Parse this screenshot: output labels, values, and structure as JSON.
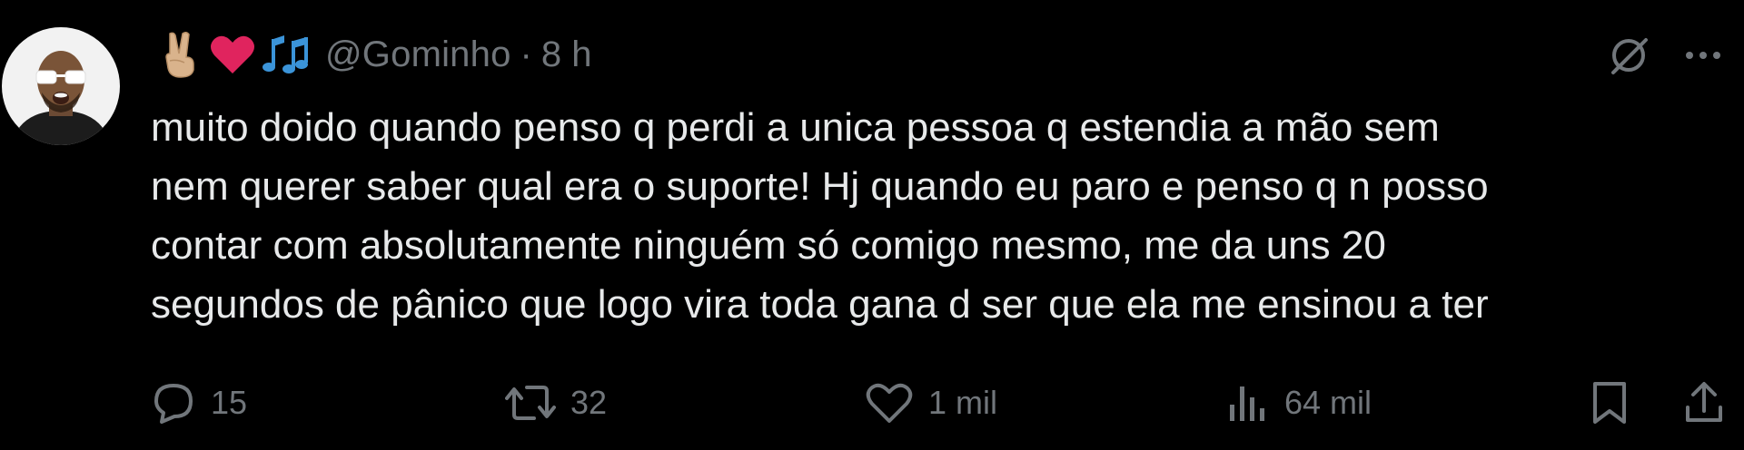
{
  "tweet": {
    "handle": "@Gominho",
    "separator": "·",
    "time": "8 h",
    "header_emojis": [
      "victory-hand",
      "red-heart",
      "musical-notes"
    ],
    "text_lines": [
      "muito doido quando penso q perdi a unica pessoa q estendia a mão sem",
      "nem querer saber qual era o suporte! Hj quando eu paro e penso q n posso",
      "contar com absolutamente ninguém só comigo mesmo, me da uns 20",
      "segundos de pânico que logo vira toda gana d ser que ela me ensinou a ter"
    ]
  },
  "actions": {
    "replies": "15",
    "reposts": "32",
    "likes": "1 mil",
    "views": "64 mil"
  },
  "colors": {
    "background": "#000000",
    "text": "#e7e9ea",
    "muted": "#71767b",
    "heart": "#e0245e",
    "notes": "#3b94d9",
    "skin": "#d9b38c"
  },
  "icons": {
    "top": [
      "grok-icon",
      "more-icon"
    ],
    "actions": [
      "reply-icon",
      "repost-icon",
      "like-icon",
      "views-icon",
      "bookmark-icon",
      "share-icon"
    ]
  }
}
